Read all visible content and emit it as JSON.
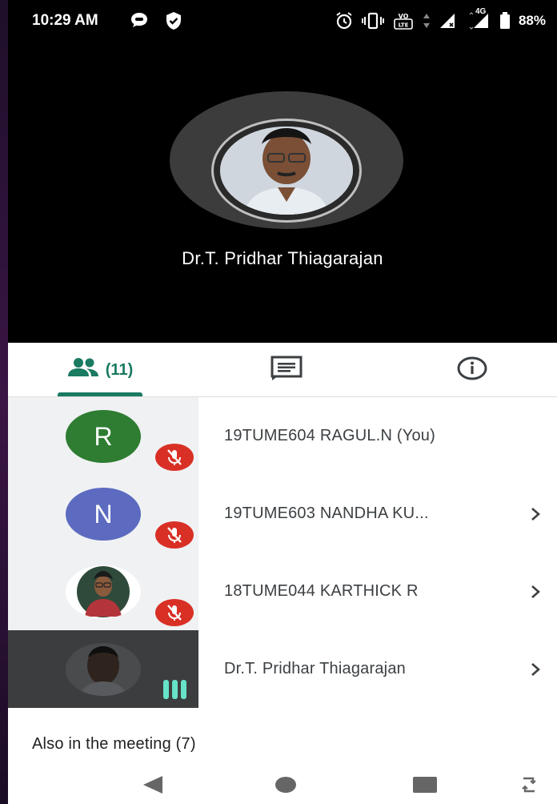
{
  "status_bar": {
    "time": "10:29 AM",
    "network": "4G",
    "battery": "88%",
    "icons": [
      "message-icon",
      "shield-icon",
      "alarm-icon",
      "vibrate-icon",
      "volte-icon",
      "signal-icon",
      "battery-icon"
    ]
  },
  "main_video": {
    "presenter_name": "Dr.T. Pridhar Thiagarajan"
  },
  "tabs": {
    "people_count": "(11)",
    "people_icon": "people-icon",
    "chat_icon": "chat-icon",
    "info_icon": "info-icon",
    "active_color": "#1a7a62"
  },
  "participants": [
    {
      "initial": "R",
      "name": "19TUME604 RAGUL.N (You)",
      "avatar_color": "#2e7d32",
      "muted": true,
      "has_chevron": false
    },
    {
      "initial": "N",
      "name": "19TUME603 NANDHA KU...",
      "avatar_color": "#5c6bc0",
      "muted": true,
      "has_chevron": true
    },
    {
      "initial": "",
      "name": "18TUME044 KARTHICK R",
      "avatar_color": "#ffffff",
      "muted": true,
      "has_chevron": true
    },
    {
      "initial": "",
      "name": "Dr.T. Pridhar Thiagarajan",
      "avatar_color": "#3c3d3f",
      "muted": false,
      "speaking": true,
      "has_chevron": true
    }
  ],
  "also_in_meeting": "Also in the meeting (7)",
  "colors": {
    "muted_badge": "#d93025",
    "speaking": "#66e3c8"
  }
}
